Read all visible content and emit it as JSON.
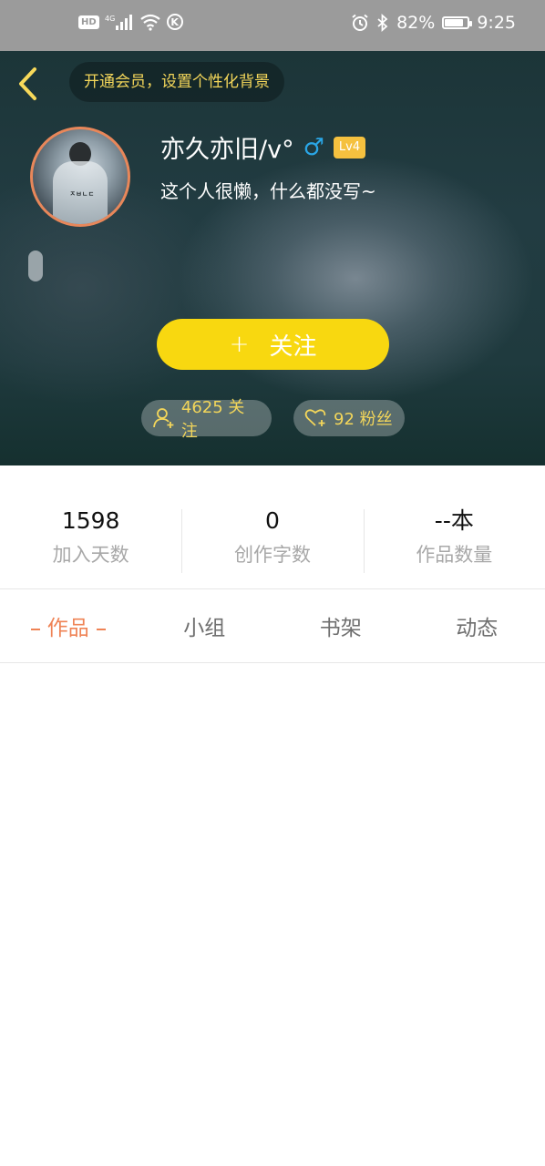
{
  "status_bar": {
    "hd": "HD",
    "network": "4G",
    "k_label": "K",
    "battery_text": "82%",
    "battery_level": 0.82,
    "time": "9:25",
    "icons": [
      "hd-icon",
      "signal-icon",
      "wifi-icon",
      "k-icon",
      "alarm-icon",
      "bluetooth-icon",
      "battery-icon"
    ]
  },
  "header": {
    "vip_banner": "开通会员，设置个性化背景",
    "avatar_caption": "ㅈㅂㄴㄷ",
    "username": "亦久亦旧/v°",
    "gender_symbol": "♂",
    "level": "Lv4",
    "bio": "这个人很懒，什么都没写~",
    "follow_plus": "+",
    "follow_button": "关注",
    "following_text": "4625 关注",
    "fans_text": "92 粉丝",
    "colors": {
      "accent_yellow": "#f8d810",
      "gold_text": "#f3d65a",
      "gender_blue": "#2aa6e6",
      "avatar_ring": "#e8875a"
    }
  },
  "stats": [
    {
      "value": "1598",
      "label": "加入天数"
    },
    {
      "value": "0",
      "label": "创作字数"
    },
    {
      "value": "--本",
      "label": "作品数量"
    }
  ],
  "tabs": [
    {
      "label": "作品",
      "active": true
    },
    {
      "label": "小组",
      "active": false
    },
    {
      "label": "书架",
      "active": false
    },
    {
      "label": "动态",
      "active": false
    }
  ],
  "active_color": "#ef8355"
}
